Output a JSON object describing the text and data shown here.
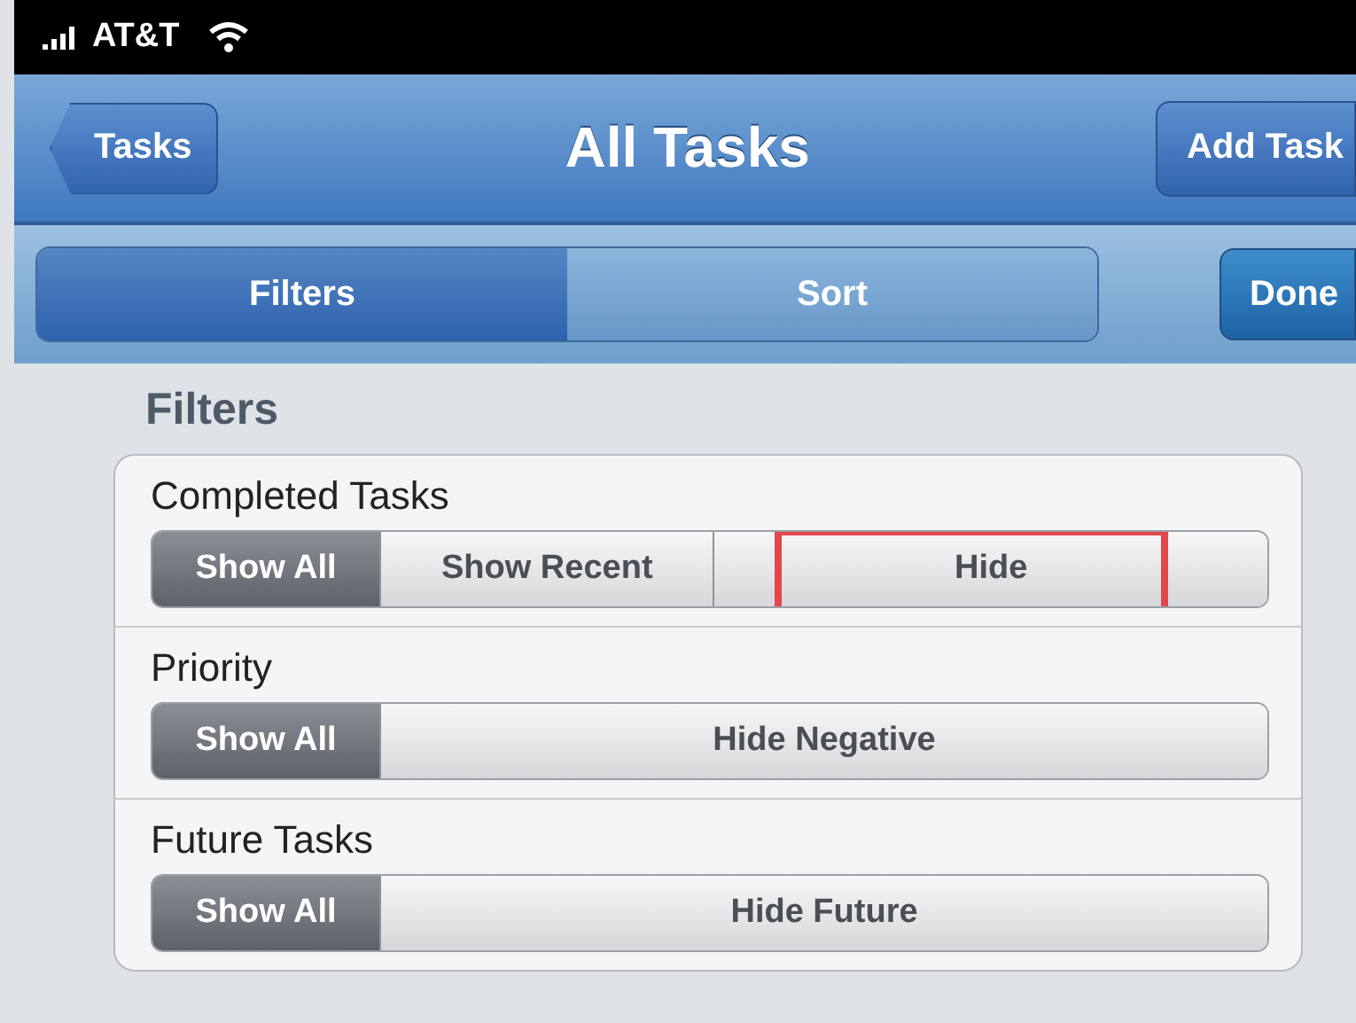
{
  "status_bar": {
    "carrier": "AT&T"
  },
  "nav_bar": {
    "back_button": "Tasks",
    "title": "All Tasks",
    "action_button": "Add Task"
  },
  "toolbar": {
    "tabs": [
      {
        "label": "Filters",
        "selected": true
      },
      {
        "label": "Sort",
        "selected": false
      }
    ],
    "done_button": "Done"
  },
  "section_title": "Filters",
  "filters": [
    {
      "label": "Completed Tasks",
      "options": [
        {
          "label": "Show All",
          "selected": true,
          "annotated": false
        },
        {
          "label": "Show Recent",
          "selected": false,
          "annotated": false
        },
        {
          "label": "Hide",
          "selected": false,
          "annotated": true
        }
      ]
    },
    {
      "label": "Priority",
      "options": [
        {
          "label": "Show All",
          "selected": true,
          "annotated": false
        },
        {
          "label": "Hide Negative",
          "selected": false,
          "annotated": false
        }
      ]
    },
    {
      "label": "Future Tasks",
      "options": [
        {
          "label": "Show All",
          "selected": true,
          "annotated": false
        },
        {
          "label": "Hide Future",
          "selected": false,
          "annotated": false
        }
      ]
    }
  ]
}
